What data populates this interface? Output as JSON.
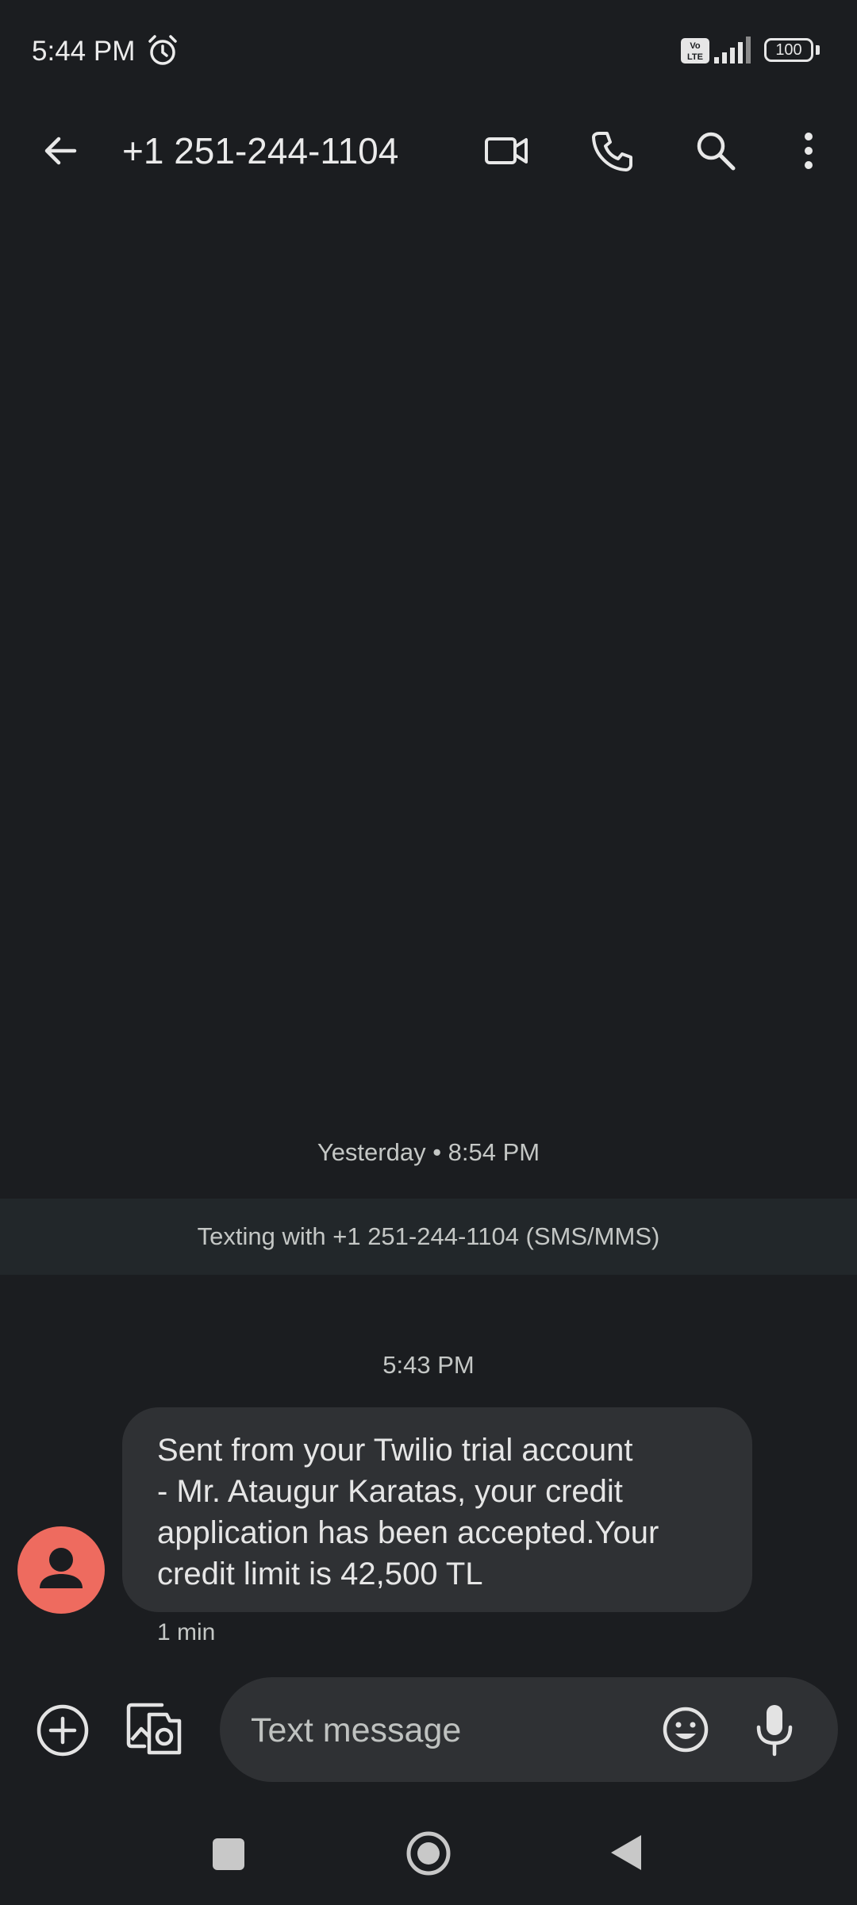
{
  "status_bar": {
    "time": "5:44 PM",
    "battery": "100",
    "icons": [
      "alarm-icon",
      "volte-icon",
      "signal-icon",
      "battery-icon"
    ]
  },
  "app_bar": {
    "title": "+1 251-244-1104",
    "icons": [
      "back-arrow-icon",
      "video-call-icon",
      "phone-icon",
      "search-icon",
      "more-vert-icon"
    ]
  },
  "conversation": {
    "date_label_1": "Yesterday • 8:54 PM",
    "info_banner": "Texting with +1 251-244-1104 (SMS/MMS)",
    "date_label_2": "5:43 PM",
    "message": {
      "lines": [
        "Sent from your Twilio trial account",
        "- Mr. Ataugur Karatas, your credit",
        "application has been accepted.Your",
        "credit limit is 42,500 TL"
      ],
      "time": "1 min"
    }
  },
  "compose": {
    "placeholder": "Text message",
    "icons": [
      "add-circle-icon",
      "gallery-icon",
      "emoji-icon",
      "mic-icon"
    ]
  },
  "nav_bar": {
    "icons": [
      "recents-icon",
      "home-icon",
      "back-icon"
    ]
  },
  "colors": {
    "background": "#1b1d20",
    "bubble": "#2f3134",
    "avatar": "#ee6b5f",
    "banner": "#22272a"
  }
}
